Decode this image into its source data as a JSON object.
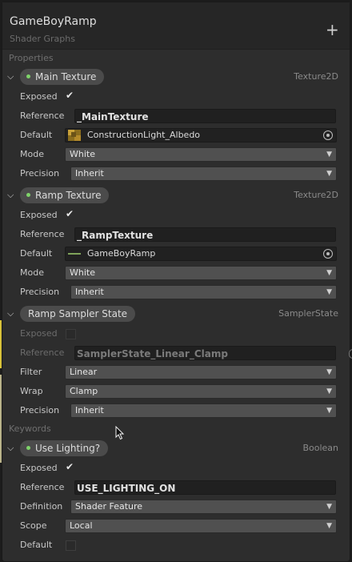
{
  "header": {
    "title": "GameBoyRamp",
    "subtitle": "Shader Graphs",
    "add_label": "+"
  },
  "properties_label": "Properties",
  "keywords_label": "Keywords",
  "labels": {
    "exposed": "Exposed",
    "reference": "Reference",
    "default": "Default",
    "mode": "Mode",
    "precision": "Precision",
    "filter": "Filter",
    "wrap": "Wrap",
    "definition": "Definition",
    "scope": "Scope"
  },
  "main_texture": {
    "name": "Main Texture",
    "type": "Texture2D",
    "exposed": true,
    "reference": "_MainTexture",
    "default": "ConstructionLight_Albedo",
    "mode": "White",
    "precision": "Inherit"
  },
  "ramp_texture": {
    "name": "Ramp Texture",
    "type": "Texture2D",
    "exposed": true,
    "reference": "_RampTexture",
    "default": "GameBoyRamp",
    "mode": "White",
    "precision": "Inherit"
  },
  "ramp_sampler": {
    "name": "Ramp Sampler State",
    "type": "SamplerState",
    "exposed": false,
    "reference": "SamplerState_Linear_Clamp",
    "filter": "Linear",
    "wrap": "Clamp",
    "precision": "Inherit"
  },
  "use_lighting": {
    "name": "Use Lighting?",
    "type": "Boolean",
    "exposed": true,
    "reference": "USE_LIGHTING_ON",
    "definition": "Shader Feature",
    "scope": "Local",
    "default": false
  },
  "icons": {
    "collapse": "chevron-down-icon",
    "exposed_dot": "exposed-dot-icon",
    "object_picker": "object-picker-icon",
    "dropdown": "dropdown-arrow-icon"
  },
  "colors": {
    "exposed_dot": "#7fd46a",
    "ramp_line": "#7fa35a"
  }
}
